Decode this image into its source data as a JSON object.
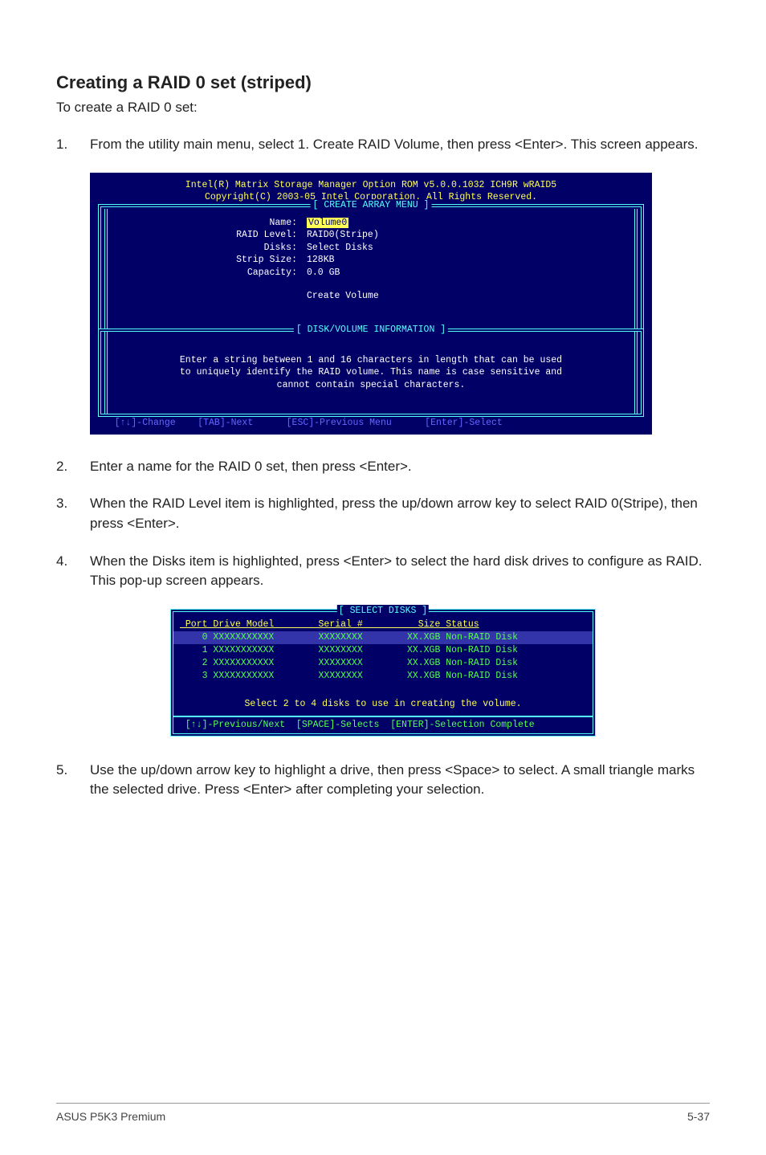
{
  "heading": "Creating a RAID 0 set (striped)",
  "lead": "To create a RAID 0 set:",
  "steps": {
    "s1_num": "1.",
    "s1_txt": "From the utility main menu, select 1. Create RAID Volume, then press <Enter>. This screen appears.",
    "s2_num": "2.",
    "s2_txt": "Enter a name for the RAID 0 set, then press <Enter>.",
    "s3_num": "3.",
    "s3_txt": "When the RAID Level item is highlighted, press the up/down arrow key to select RAID 0(Stripe), then press <Enter>.",
    "s4_num": "4.",
    "s4_txt": "When the Disks item is highlighted, press <Enter> to select the hard disk drives to configure as RAID. This pop-up screen appears.",
    "s5_num": "5.",
    "s5_txt": "Use the up/down arrow key to highlight a drive, then press <Space>  to select. A small triangle marks the selected drive. Press <Enter> after completing your selection."
  },
  "console1": {
    "title1": "Intel(R) Matrix Storage Manager Option ROM v5.0.0.1032 ICH9R wRAID5",
    "title2": "Copyright(C) 2003-05 Intel Corporation. All Rights Reserved.",
    "menu_title": "[ CREATE ARRAY MENU ]",
    "name_lbl": "Name:",
    "name_val": "Volume0",
    "raid_lbl": "RAID Level:",
    "raid_val": "RAID0(Stripe)",
    "disks_lbl": "Disks:",
    "disks_val": "Select Disks",
    "strip_lbl": "Strip Size:",
    "strip_val": "128KB",
    "cap_lbl": "Capacity:",
    "cap_val": "0.0   GB",
    "create": "Create Volume",
    "info_title": "[ DISK/VOLUME INFORMATION ]",
    "info1": "Enter a string between 1 and 16 characters in length that can be used",
    "info2": "to uniquely identify the RAID volume. This name is case sensitive and",
    "info3": "cannot contain special characters.",
    "kb": "   [↑↓]-Change    [TAB]-Next      [ESC]-Previous Menu      [Enter]-Select   "
  },
  "console2": {
    "title": "[ SELECT DISKS ]",
    "header": " Port Drive Model        Serial #          Size Status",
    "r0": "    0 XXXXXXXXXXX        XXXXXXXX        XX.XGB Non-RAID Disk",
    "r1": "    1 XXXXXXXXXXX        XXXXXXXX        XX.XGB Non-RAID Disk",
    "r2": "    2 XXXXXXXXXXX        XXXXXXXX        XX.XGB Non-RAID Disk",
    "r3": "    3 XXXXXXXXXXX        XXXXXXXX        XX.XGB Non-RAID Disk",
    "help": "Select 2 to 4 disks to use in creating the volume.",
    "kb": " [↑↓]-Previous/Next  [SPACE]-Selects  [ENTER]-Selection Complete "
  },
  "footer_left": "ASUS P5K3 Premium",
  "footer_right": "5-37"
}
